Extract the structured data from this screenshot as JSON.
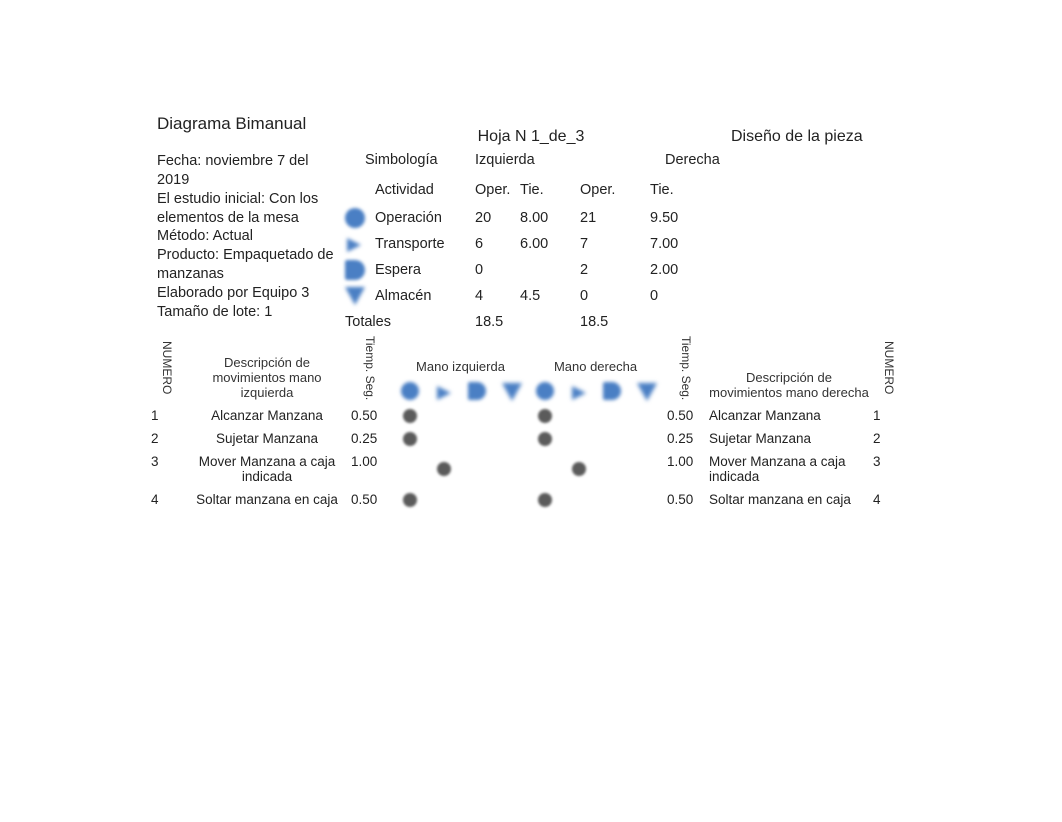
{
  "header": {
    "title": "Diagrama Bimanual",
    "sheet": "Hoja N 1_de_3",
    "design": "Diseño de la pieza"
  },
  "info": {
    "fecha": "Fecha: noviembre 7 del 2019",
    "estudio": "El estudio inicial: Con los elementos de la mesa",
    "metodo": "Método: Actual",
    "producto": "Producto: Empaquetado de manzanas",
    "elaborado": "Elaborado por Equipo 3",
    "lote": "Tamaño de lote: 1"
  },
  "simbologia": {
    "label": "Simbología",
    "izq": "Izquierda",
    "der": "Derecha",
    "actividad": "Actividad",
    "oper": "Oper.",
    "tie": "Tie.",
    "rows": [
      {
        "name": "Operación",
        "lop": "20",
        "ltie": "8.00",
        "rop": "21",
        "rtie": "9.50"
      },
      {
        "name": "Transporte",
        "lop": "6",
        "ltie": "6.00",
        "rop": "7",
        "rtie": "7.00"
      },
      {
        "name": "Espera",
        "lop": "0",
        "ltie": "",
        "rop": "2",
        "rtie": "2.00"
      },
      {
        "name": "Almacén",
        "lop": "4",
        "ltie": "4.5",
        "rop": "0",
        "rtie": "0"
      }
    ],
    "totales": {
      "label": "Totales",
      "l": "18.5",
      "r": "18.5"
    }
  },
  "detail": {
    "numero": "NUMERO",
    "desc_izq": "Descripción de movimientos mano izquierda",
    "desc_der": "Descripción de movimientos mano derecha",
    "tiemp": "Tiemp. Seg.",
    "mano_izq": "Mano izquierda",
    "mano_der": "Mano derecha",
    "rows": [
      {
        "n": "1",
        "li": "Alcanzar Manzana",
        "lt": "0.50",
        "rt": "0.50",
        "ri": "Alcanzar Manzana",
        "rn": "1",
        "mcol": 0
      },
      {
        "n": "2",
        "li": "Sujetar Manzana",
        "lt": "0.25",
        "rt": "0.25",
        "ri": "Sujetar Manzana",
        "rn": "2",
        "mcol": 0
      },
      {
        "n": "3",
        "li": "Mover Manzana a caja indicada",
        "lt": "1.00",
        "rt": "1.00",
        "ri": "Mover Manzana a caja indicada",
        "rn": "3",
        "mcol": 1
      },
      {
        "n": "4",
        "li": "Soltar manzana en caja",
        "lt": "0.50",
        "rt": "0.50",
        "ri": "Soltar manzana en caja",
        "rn": "4",
        "mcol": 0
      }
    ]
  }
}
